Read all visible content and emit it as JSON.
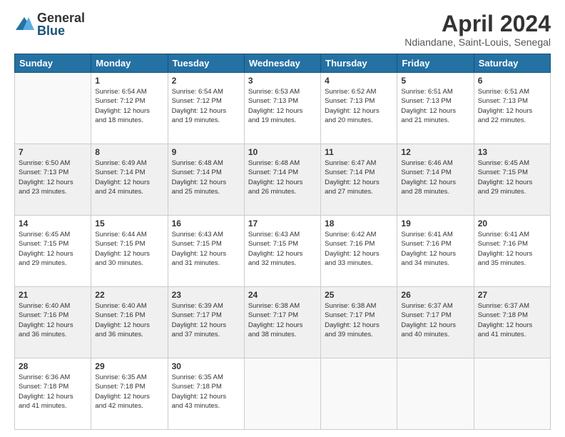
{
  "logo": {
    "general": "General",
    "blue": "Blue"
  },
  "title": "April 2024",
  "location": "Ndiandane, Saint-Louis, Senegal",
  "days_of_week": [
    "Sunday",
    "Monday",
    "Tuesday",
    "Wednesday",
    "Thursday",
    "Friday",
    "Saturday"
  ],
  "weeks": [
    [
      {
        "day": "",
        "info": ""
      },
      {
        "day": "1",
        "info": "Sunrise: 6:54 AM\nSunset: 7:12 PM\nDaylight: 12 hours\nand 18 minutes."
      },
      {
        "day": "2",
        "info": "Sunrise: 6:54 AM\nSunset: 7:12 PM\nDaylight: 12 hours\nand 19 minutes."
      },
      {
        "day": "3",
        "info": "Sunrise: 6:53 AM\nSunset: 7:13 PM\nDaylight: 12 hours\nand 19 minutes."
      },
      {
        "day": "4",
        "info": "Sunrise: 6:52 AM\nSunset: 7:13 PM\nDaylight: 12 hours\nand 20 minutes."
      },
      {
        "day": "5",
        "info": "Sunrise: 6:51 AM\nSunset: 7:13 PM\nDaylight: 12 hours\nand 21 minutes."
      },
      {
        "day": "6",
        "info": "Sunrise: 6:51 AM\nSunset: 7:13 PM\nDaylight: 12 hours\nand 22 minutes."
      }
    ],
    [
      {
        "day": "7",
        "info": "Sunrise: 6:50 AM\nSunset: 7:13 PM\nDaylight: 12 hours\nand 23 minutes."
      },
      {
        "day": "8",
        "info": "Sunrise: 6:49 AM\nSunset: 7:14 PM\nDaylight: 12 hours\nand 24 minutes."
      },
      {
        "day": "9",
        "info": "Sunrise: 6:48 AM\nSunset: 7:14 PM\nDaylight: 12 hours\nand 25 minutes."
      },
      {
        "day": "10",
        "info": "Sunrise: 6:48 AM\nSunset: 7:14 PM\nDaylight: 12 hours\nand 26 minutes."
      },
      {
        "day": "11",
        "info": "Sunrise: 6:47 AM\nSunset: 7:14 PM\nDaylight: 12 hours\nand 27 minutes."
      },
      {
        "day": "12",
        "info": "Sunrise: 6:46 AM\nSunset: 7:14 PM\nDaylight: 12 hours\nand 28 minutes."
      },
      {
        "day": "13",
        "info": "Sunrise: 6:45 AM\nSunset: 7:15 PM\nDaylight: 12 hours\nand 29 minutes."
      }
    ],
    [
      {
        "day": "14",
        "info": "Sunrise: 6:45 AM\nSunset: 7:15 PM\nDaylight: 12 hours\nand 29 minutes."
      },
      {
        "day": "15",
        "info": "Sunrise: 6:44 AM\nSunset: 7:15 PM\nDaylight: 12 hours\nand 30 minutes."
      },
      {
        "day": "16",
        "info": "Sunrise: 6:43 AM\nSunset: 7:15 PM\nDaylight: 12 hours\nand 31 minutes."
      },
      {
        "day": "17",
        "info": "Sunrise: 6:43 AM\nSunset: 7:15 PM\nDaylight: 12 hours\nand 32 minutes."
      },
      {
        "day": "18",
        "info": "Sunrise: 6:42 AM\nSunset: 7:16 PM\nDaylight: 12 hours\nand 33 minutes."
      },
      {
        "day": "19",
        "info": "Sunrise: 6:41 AM\nSunset: 7:16 PM\nDaylight: 12 hours\nand 34 minutes."
      },
      {
        "day": "20",
        "info": "Sunrise: 6:41 AM\nSunset: 7:16 PM\nDaylight: 12 hours\nand 35 minutes."
      }
    ],
    [
      {
        "day": "21",
        "info": "Sunrise: 6:40 AM\nSunset: 7:16 PM\nDaylight: 12 hours\nand 36 minutes."
      },
      {
        "day": "22",
        "info": "Sunrise: 6:40 AM\nSunset: 7:16 PM\nDaylight: 12 hours\nand 36 minutes."
      },
      {
        "day": "23",
        "info": "Sunrise: 6:39 AM\nSunset: 7:17 PM\nDaylight: 12 hours\nand 37 minutes."
      },
      {
        "day": "24",
        "info": "Sunrise: 6:38 AM\nSunset: 7:17 PM\nDaylight: 12 hours\nand 38 minutes."
      },
      {
        "day": "25",
        "info": "Sunrise: 6:38 AM\nSunset: 7:17 PM\nDaylight: 12 hours\nand 39 minutes."
      },
      {
        "day": "26",
        "info": "Sunrise: 6:37 AM\nSunset: 7:17 PM\nDaylight: 12 hours\nand 40 minutes."
      },
      {
        "day": "27",
        "info": "Sunrise: 6:37 AM\nSunset: 7:18 PM\nDaylight: 12 hours\nand 41 minutes."
      }
    ],
    [
      {
        "day": "28",
        "info": "Sunrise: 6:36 AM\nSunset: 7:18 PM\nDaylight: 12 hours\nand 41 minutes."
      },
      {
        "day": "29",
        "info": "Sunrise: 6:35 AM\nSunset: 7:18 PM\nDaylight: 12 hours\nand 42 minutes."
      },
      {
        "day": "30",
        "info": "Sunrise: 6:35 AM\nSunset: 7:18 PM\nDaylight: 12 hours\nand 43 minutes."
      },
      {
        "day": "",
        "info": ""
      },
      {
        "day": "",
        "info": ""
      },
      {
        "day": "",
        "info": ""
      },
      {
        "day": "",
        "info": ""
      }
    ]
  ]
}
